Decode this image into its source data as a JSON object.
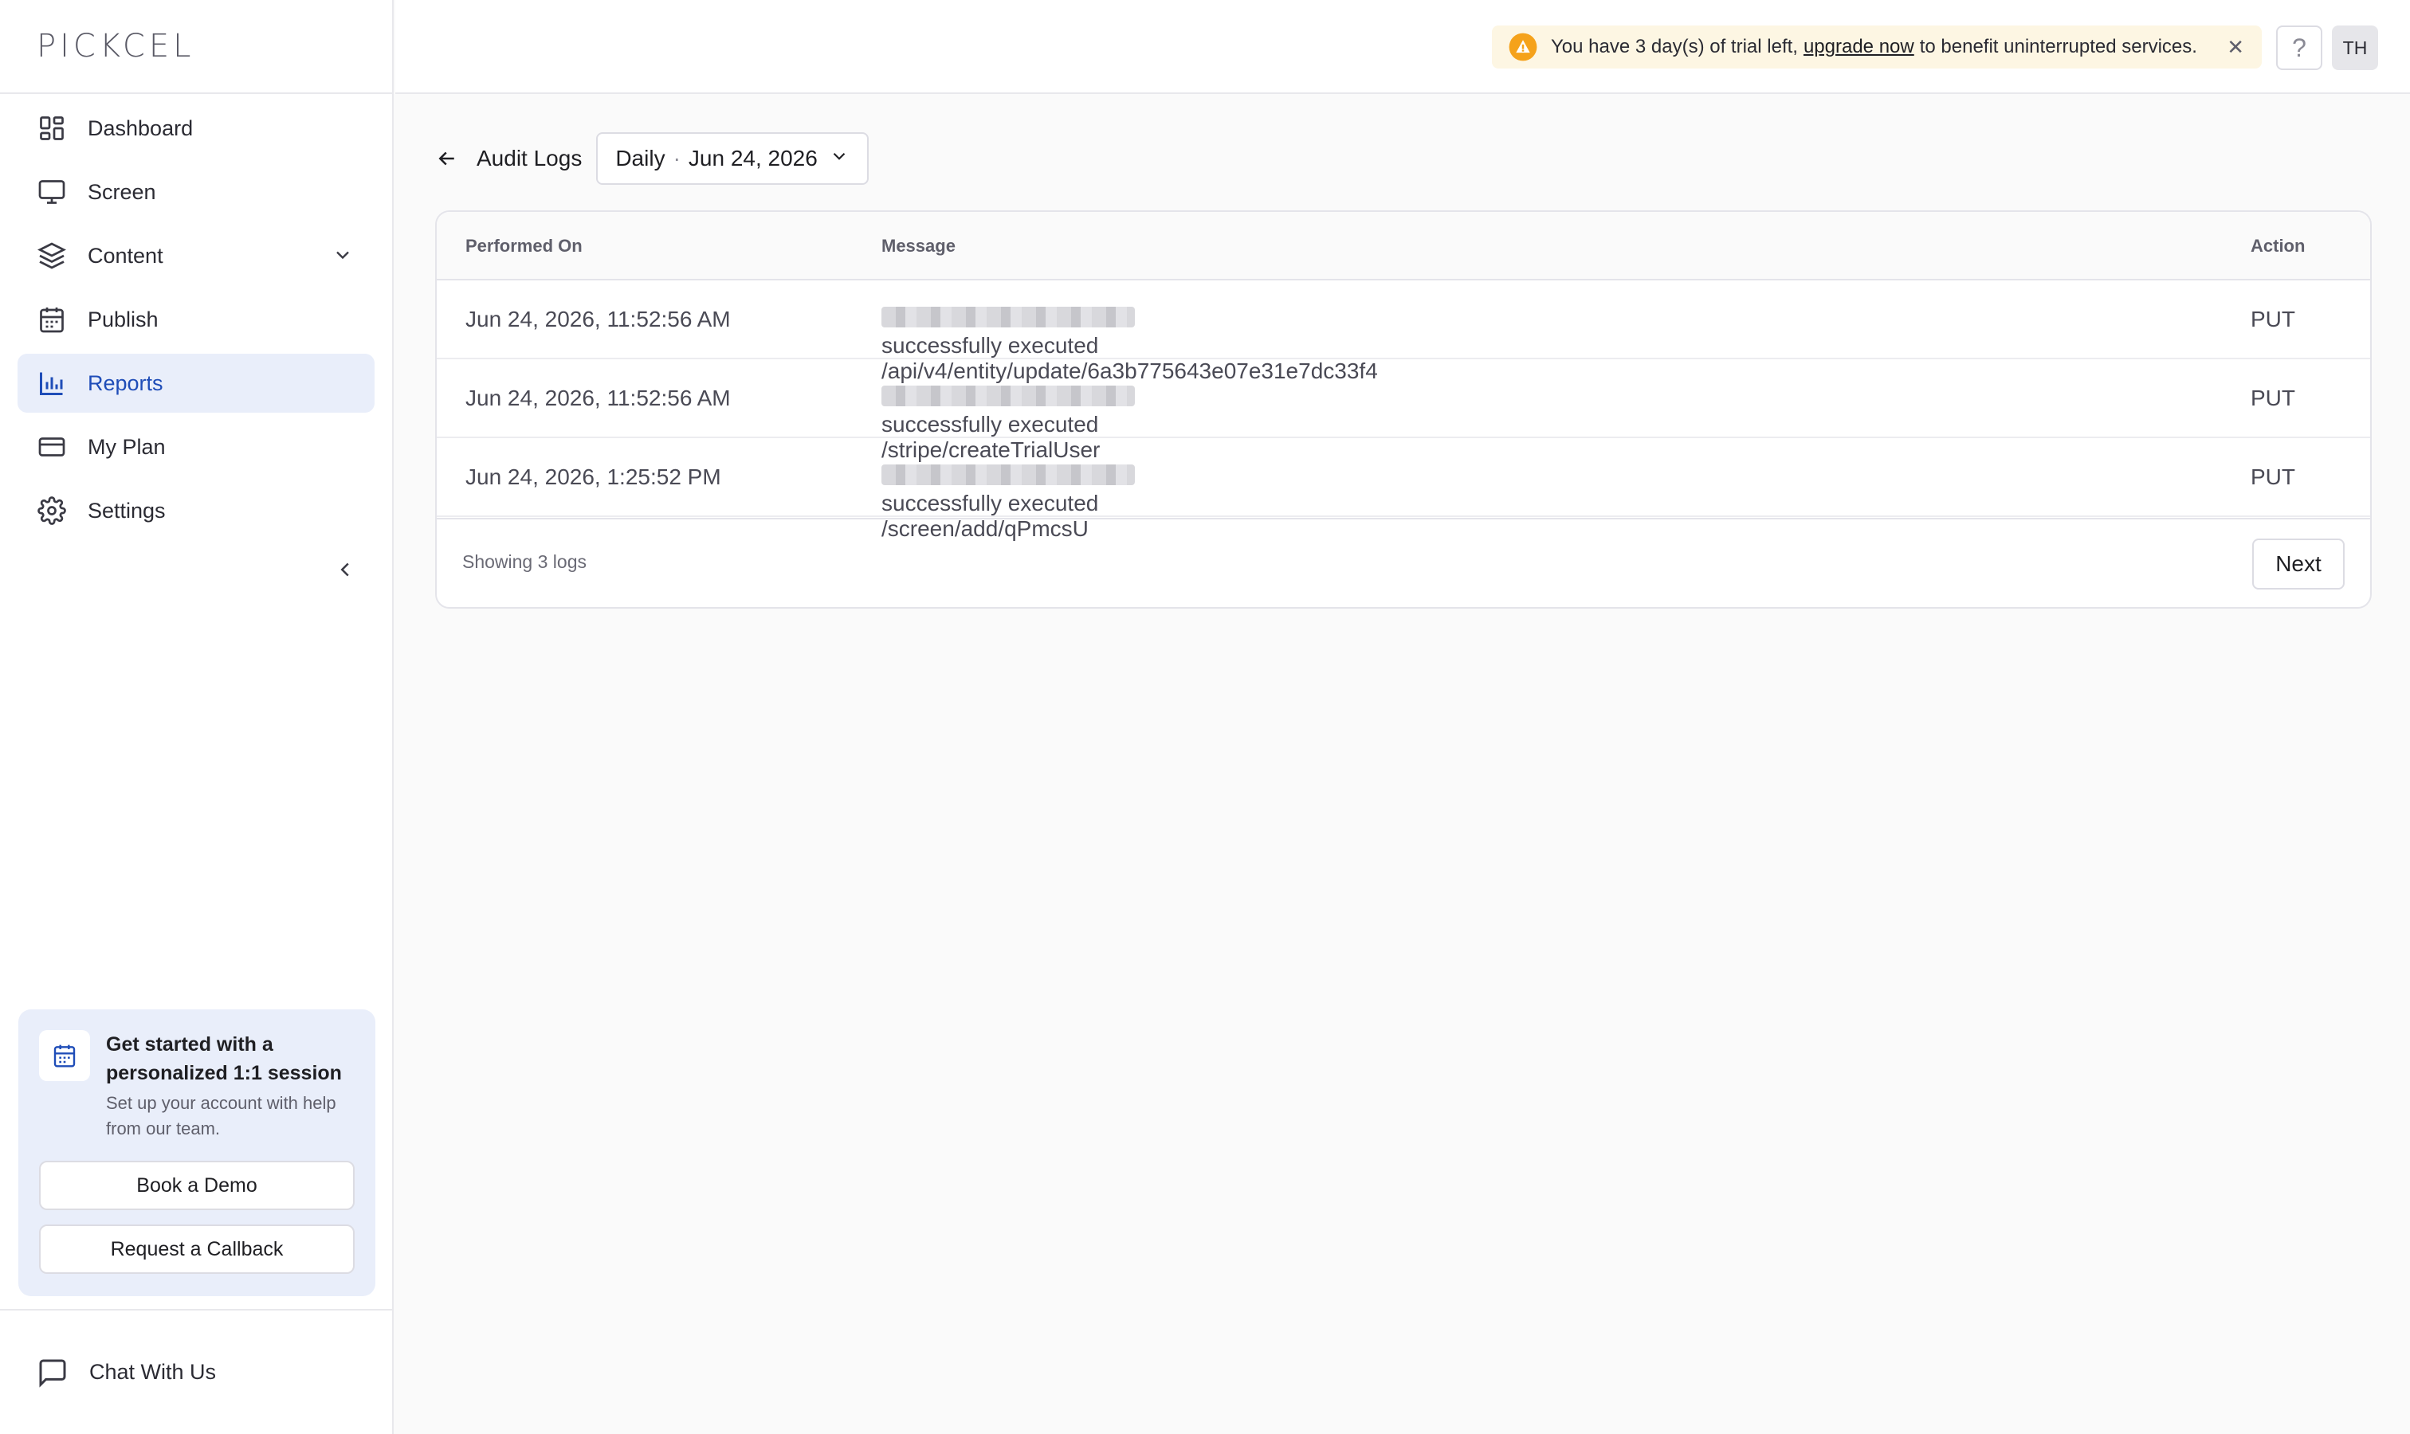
{
  "brand": {
    "logo": "PICKCEL"
  },
  "sidebar": {
    "items": [
      {
        "label": "Dashboard",
        "icon": "dashboard-icon"
      },
      {
        "label": "Screen",
        "icon": "monitor-icon"
      },
      {
        "label": "Content",
        "icon": "layers-icon"
      },
      {
        "label": "Publish",
        "icon": "calendar-icon"
      },
      {
        "label": "Reports",
        "icon": "bar-chart-icon",
        "active": true
      },
      {
        "label": "My Plan",
        "icon": "credit-card-icon"
      },
      {
        "label": "Settings",
        "icon": "gear-icon"
      }
    ],
    "promo": {
      "title": "Get started with a personalized 1:1 session",
      "subtitle": "Set up your account with help from our team.",
      "book_label": "Book a Demo",
      "callback_label": "Request a Callback"
    },
    "chat_label": "Chat With Us"
  },
  "topbar": {
    "trial_prefix": "You have 3 day(s) of trial left,",
    "trial_link": "upgrade now",
    "trial_suffix": "to benefit uninterrupted services.",
    "help": "?",
    "avatar_initials": "TH"
  },
  "page": {
    "title": "Audit Logs",
    "range_period": "Daily",
    "range_date": "Jun 24, 2026"
  },
  "table": {
    "columns": [
      "Performed On",
      "Message",
      "Action"
    ],
    "rows": [
      {
        "performed_on": "Jun 24, 2026, 11:52:56 AM",
        "message": "successfully executed /api/v4/entity/update/6a3b775643e07e31e7dc33f4",
        "action": "PUT"
      },
      {
        "performed_on": "Jun 24, 2026, 11:52:56 AM",
        "message": "successfully executed /stripe/createTrialUser",
        "action": "PUT"
      },
      {
        "performed_on": "Jun 24, 2026, 1:25:52 PM",
        "message": "successfully executed /screen/add/qPmcsU",
        "action": "PUT"
      }
    ],
    "footer_count": "Showing 3 logs",
    "next_label": "Next"
  },
  "colors": {
    "accent": "#1f4db8",
    "active_bg": "#e9eefa",
    "warning": "#f5a21b"
  }
}
